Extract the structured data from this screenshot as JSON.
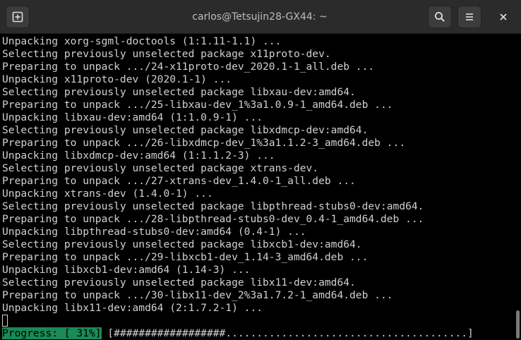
{
  "window": {
    "title": "carlos@Tetsujin28-GX44: ~"
  },
  "titlebar": {
    "icons": {
      "new_tab": "new-tab-icon",
      "search": "search-icon",
      "menu": "hamburger-menu-icon",
      "close": "close-icon"
    }
  },
  "terminal": {
    "lines": [
      "Unpacking xorg-sgml-doctools (1:1.11-1.1) ...",
      "Selecting previously unselected package x11proto-dev.",
      "Preparing to unpack .../24-x11proto-dev_2020.1-1_all.deb ...",
      "Unpacking x11proto-dev (2020.1-1) ...",
      "Selecting previously unselected package libxau-dev:amd64.",
      "Preparing to unpack .../25-libxau-dev_1%3a1.0.9-1_amd64.deb ...",
      "Unpacking libxau-dev:amd64 (1:1.0.9-1) ...",
      "Selecting previously unselected package libxdmcp-dev:amd64.",
      "Preparing to unpack .../26-libxdmcp-dev_1%3a1.1.2-3_amd64.deb ...",
      "Unpacking libxdmcp-dev:amd64 (1:1.1.2-3) ...",
      "Selecting previously unselected package xtrans-dev.",
      "Preparing to unpack .../27-xtrans-dev_1.4.0-1_all.deb ...",
      "Unpacking xtrans-dev (1.4.0-1) ...",
      "Selecting previously unselected package libpthread-stubs0-dev:amd64.",
      "Preparing to unpack .../28-libpthread-stubs0-dev_0.4-1_amd64.deb ...",
      "Unpacking libpthread-stubs0-dev:amd64 (0.4-1) ...",
      "Selecting previously unselected package libxcb1-dev:amd64.",
      "Preparing to unpack .../29-libxcb1-dev_1.14-3_amd64.deb ...",
      "Unpacking libxcb1-dev:amd64 (1.14-3) ...",
      "Selecting previously unselected package libx11-dev:amd64.",
      "Preparing to unpack .../30-libx11-dev_2%3a1.7.2-1_amd64.deb ...",
      "Unpacking libx11-dev:amd64 (2:1.7.2-1) ..."
    ],
    "progress": {
      "label": "Progress: [ 31%]",
      "bar": "[##################.......................................]",
      "percent": 31
    }
  },
  "colors": {
    "titlebar_bg": "#2b2b2b",
    "terminal_bg": "#000000",
    "terminal_fg": "#d0d0d0",
    "progress_label_bg": "#1a8a56"
  }
}
